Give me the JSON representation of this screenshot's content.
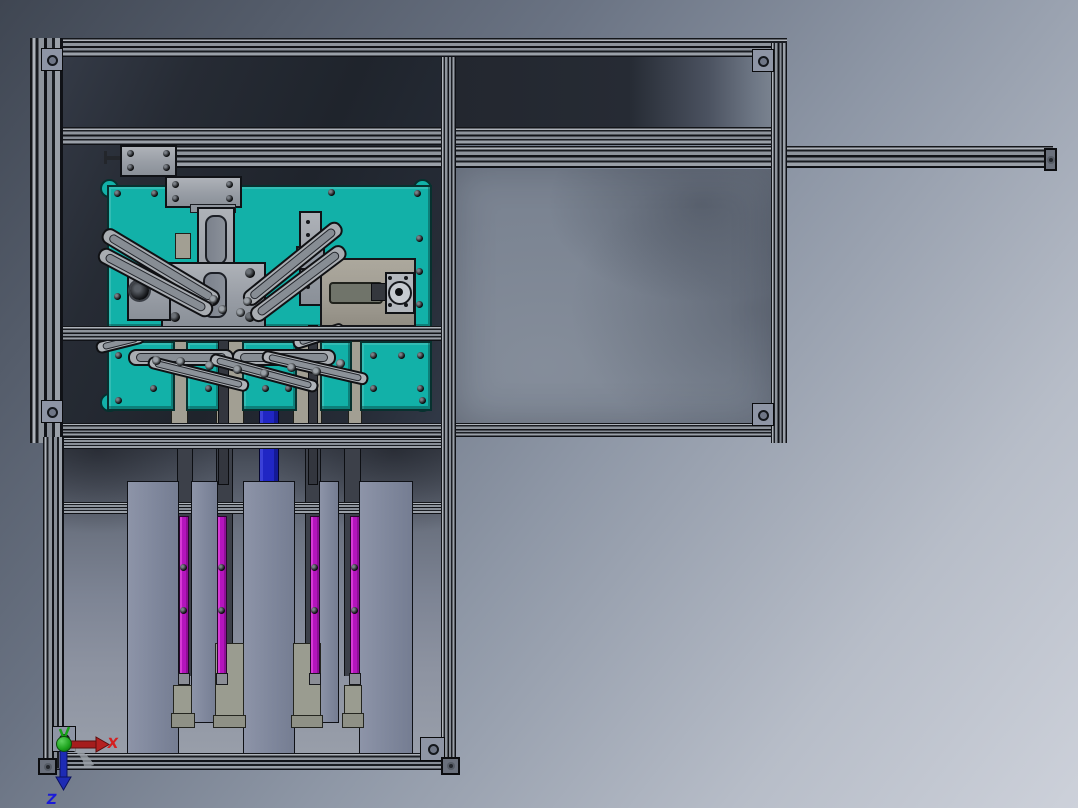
{
  "scene": {
    "type": "cad-assembly-front-view",
    "description_visible_text_only": true,
    "axis_triad": {
      "x_label": "X",
      "z_label": "Z"
    },
    "colors": {
      "background_top_left": "#3f4652",
      "background_bottom_right": "#cdd1da",
      "panel_dark": "#1f242c",
      "panel_medium": "#7b8492",
      "frame_gray": "#8e949c",
      "fixture_plate_teal": "#12b1a8",
      "locator_magenta": "#b414bd",
      "slider_blue": "#2026c4",
      "column_gray": "#828aa0",
      "tan_block": "#a29f93",
      "axis_x_red": "#d42020",
      "axis_z_blue": "#1b1bd8",
      "axis_y_green": "#1ca21c"
    },
    "icons": [
      "origin-triad-icon"
    ]
  }
}
